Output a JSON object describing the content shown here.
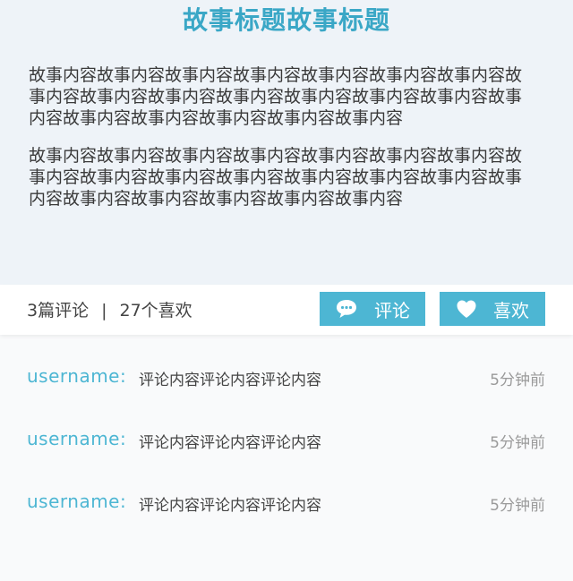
{
  "story": {
    "title": "故事标题故事标题",
    "paragraphs": [
      "故事内容故事内容故事内容故事内容故事内容故事内容故事内容故事内容故事内容故事内容故事内容故事内容故事内容故事内容故事内容故事内容故事内容故事内容故事内容故事内容",
      "故事内容故事内容故事内容故事内容故事内容故事内容故事内容故事内容故事内容故事内容故事内容故事内容故事内容故事内容故事内容故事内容故事内容故事内容故事内容故事内容"
    ]
  },
  "stats": {
    "comments": "3篇评论",
    "separator": "|",
    "likes": "27个喜欢"
  },
  "actions": {
    "comment_label": "评论",
    "like_label": "喜欢",
    "comment_icon": "chat-bubble-icon",
    "like_icon": "heart-icon"
  },
  "comments": [
    {
      "user": "username:",
      "text": "评论内容评论内容评论内容",
      "time": "5分钟前"
    },
    {
      "user": "username:",
      "text": "评论内容评论内容评论内容",
      "time": "5分钟前"
    },
    {
      "user": "username:",
      "text": "评论内容评论内容评论内容",
      "time": "5分钟前"
    }
  ],
  "colors": {
    "accent": "#4db6d3",
    "title": "#3aa7c6",
    "story_bg": "#eef3f8"
  }
}
